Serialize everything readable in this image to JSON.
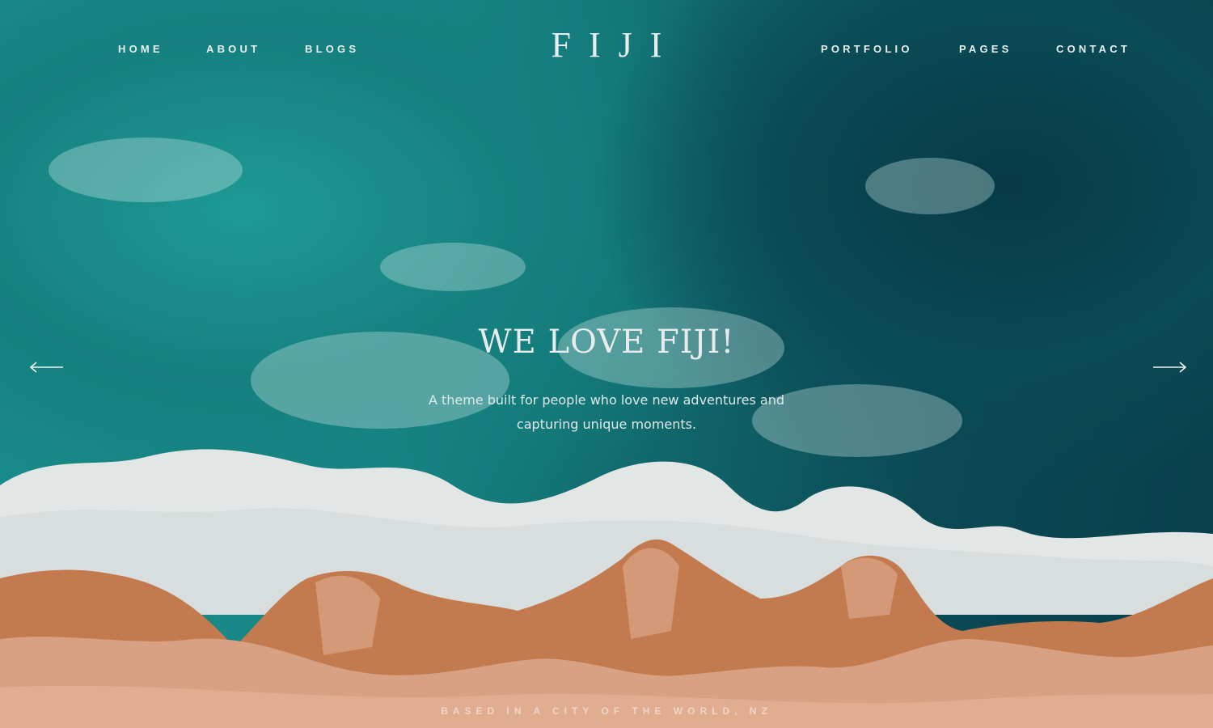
{
  "brand": {
    "logo": "FIJI"
  },
  "nav": {
    "left": [
      "HOME",
      "ABOUT",
      "BLOGS"
    ],
    "right": [
      "PORTFOLIO",
      "PAGES",
      "CONTACT"
    ]
  },
  "hero": {
    "title": "WE LOVE FIJI!",
    "subtitle": "A theme built for people who love new adventures and capturing unique moments."
  },
  "slider": {
    "prev_icon": "arrow-left-icon",
    "next_icon": "arrow-right-icon"
  },
  "footer": {
    "tagline": "BASED IN A CITY OF THE WORLD, NZ"
  },
  "colors": {
    "sea_light": "#1a8f8d",
    "sea_deep": "#083f4b",
    "foam": "#e6ebea",
    "sand": "#d9a184",
    "sand_dark": "#c47a4f",
    "text": "#e9f1f0"
  }
}
